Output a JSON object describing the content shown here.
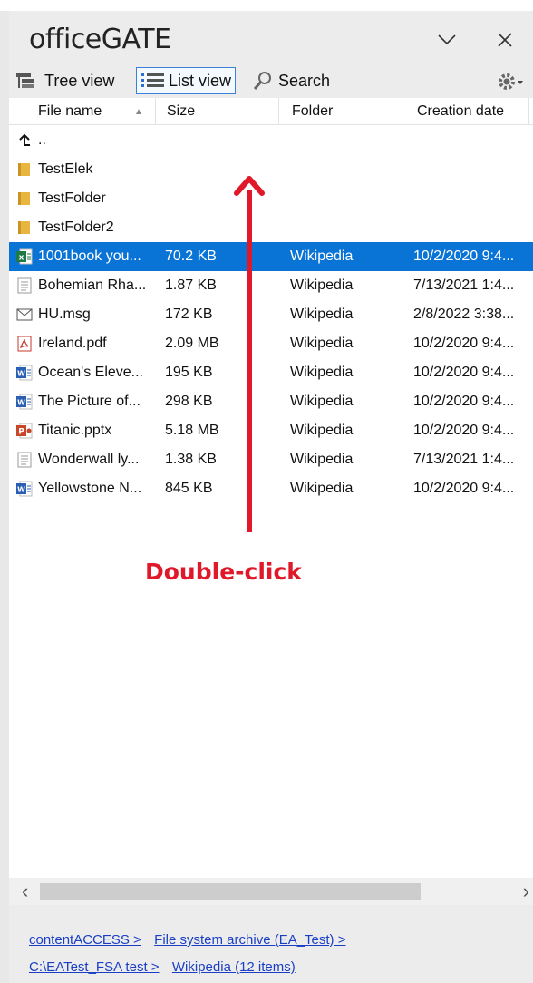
{
  "app": {
    "title": "officeGATE"
  },
  "toolbar": {
    "tree_view": "Tree view",
    "list_view": "List view",
    "search": "Search"
  },
  "columns": [
    "File name",
    "Size",
    "Folder",
    "Creation date"
  ],
  "rows": [
    {
      "name": "..",
      "size": "",
      "folder": "",
      "date": "",
      "icon": "up-arrow-icon"
    },
    {
      "name": "TestElek",
      "size": "",
      "folder": "",
      "date": "",
      "icon": "folder-icon"
    },
    {
      "name": "TestFolder",
      "size": "",
      "folder": "",
      "date": "",
      "icon": "folder-icon"
    },
    {
      "name": "TestFolder2",
      "size": "",
      "folder": "",
      "date": "",
      "icon": "folder-icon"
    },
    {
      "name": "1001book you...",
      "size": "70.2 KB",
      "folder": "Wikipedia",
      "date": "10/2/2020 9:4...",
      "icon": "excel-file-icon",
      "selected": true
    },
    {
      "name": "Bohemian Rha...",
      "size": "1.87 KB",
      "folder": "Wikipedia",
      "date": "7/13/2021 1:4...",
      "icon": "text-file-icon"
    },
    {
      "name": "HU.msg",
      "size": "172 KB",
      "folder": "Wikipedia",
      "date": "2/8/2022 3:38...",
      "icon": "mail-file-icon"
    },
    {
      "name": "Ireland.pdf",
      "size": "2.09 MB",
      "folder": "Wikipedia",
      "date": "10/2/2020 9:4...",
      "icon": "pdf-file-icon"
    },
    {
      "name": "Ocean's Eleve...",
      "size": "195 KB",
      "folder": "Wikipedia",
      "date": "10/2/2020 9:4...",
      "icon": "word-file-icon"
    },
    {
      "name": "The Picture of...",
      "size": "298 KB",
      "folder": "Wikipedia",
      "date": "10/2/2020 9:4...",
      "icon": "word-file-icon"
    },
    {
      "name": "Titanic.pptx",
      "size": "5.18 MB",
      "folder": "Wikipedia",
      "date": "10/2/2020 9:4...",
      "icon": "powerpoint-file-icon"
    },
    {
      "name": "Wonderwall ly...",
      "size": "1.38 KB",
      "folder": "Wikipedia",
      "date": "7/13/2021 1:4...",
      "icon": "text-file-icon"
    },
    {
      "name": "Yellowstone N...",
      "size": "845 KB",
      "folder": "Wikipedia",
      "date": "10/2/2020 9:4...",
      "icon": "word-file-icon"
    }
  ],
  "annotation": {
    "text": "Double-click",
    "color": "#e0192a"
  },
  "breadcrumb": {
    "items": [
      "contentACCESS >",
      "File system archive (EA_Test) >",
      "C:\\EATest_FSA test >",
      "Wikipedia (12 items)"
    ]
  },
  "colors": {
    "selection": "#0a74d6",
    "link": "#1a3fc4",
    "panel": "#ececec"
  }
}
